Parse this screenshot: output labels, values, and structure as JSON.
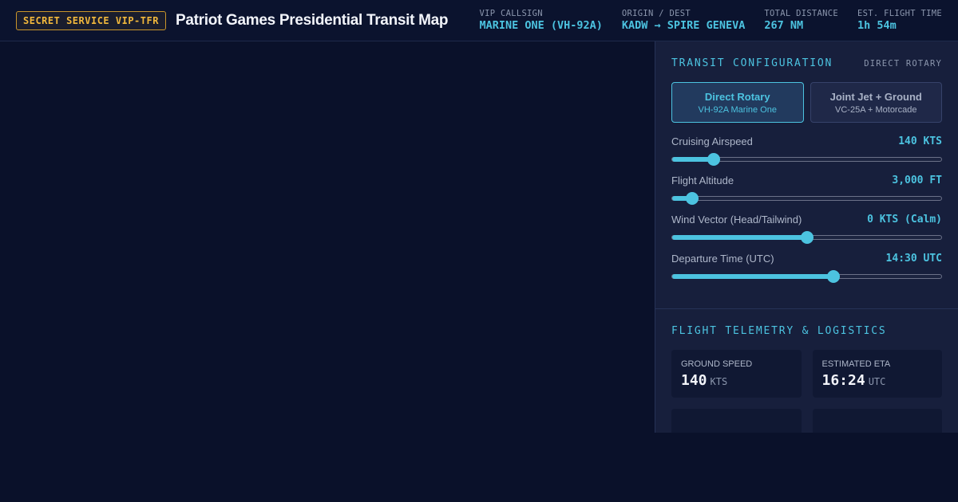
{
  "header": {
    "badge": "SECRET SERVICE VIP-TFR",
    "title": "Patriot Games Presidential Transit Map",
    "stats": [
      {
        "label": "VIP CALLSIGN",
        "value": "MARINE ONE (VH-92A)"
      },
      {
        "label": "ORIGIN / DEST",
        "value": "KADW → SPIRE GENEVA"
      },
      {
        "label": "TOTAL DISTANCE",
        "value": "267 NM"
      },
      {
        "label": "EST. FLIGHT TIME",
        "value": "1h 54m"
      }
    ]
  },
  "config": {
    "title": "TRANSIT CONFIGURATION",
    "tag": "DIRECT ROTARY",
    "modes": [
      {
        "title": "Direct Rotary",
        "sub": "VH-92A Marine One",
        "active": true
      },
      {
        "title": "Joint Jet + Ground",
        "sub": "VC-25A + Motorcade",
        "active": false
      }
    ],
    "sliders": [
      {
        "label": "Cruising Airspeed",
        "value": "140 KTS",
        "fraction": 0.155
      },
      {
        "label": "Flight Altitude",
        "value": "3,000 FT",
        "fraction": 0.075
      },
      {
        "label": "Wind Vector (Head/Tailwind)",
        "value": "0 KTS (Calm)",
        "fraction": 0.5
      },
      {
        "label": "Departure Time (UTC)",
        "value": "14:30 UTC",
        "fraction": 0.6
      }
    ]
  },
  "telemetry": {
    "title": "FLIGHT TELEMETRY & LOGISTICS",
    "cards": [
      {
        "label": "GROUND SPEED",
        "value": "140",
        "unit": "KTS"
      },
      {
        "label": "ESTIMATED ETA",
        "value": "16:24",
        "unit": "UTC"
      }
    ]
  },
  "colors": {
    "accent": "#4cc3e0",
    "badge": "#f2b83c",
    "background": "#0a112a"
  }
}
